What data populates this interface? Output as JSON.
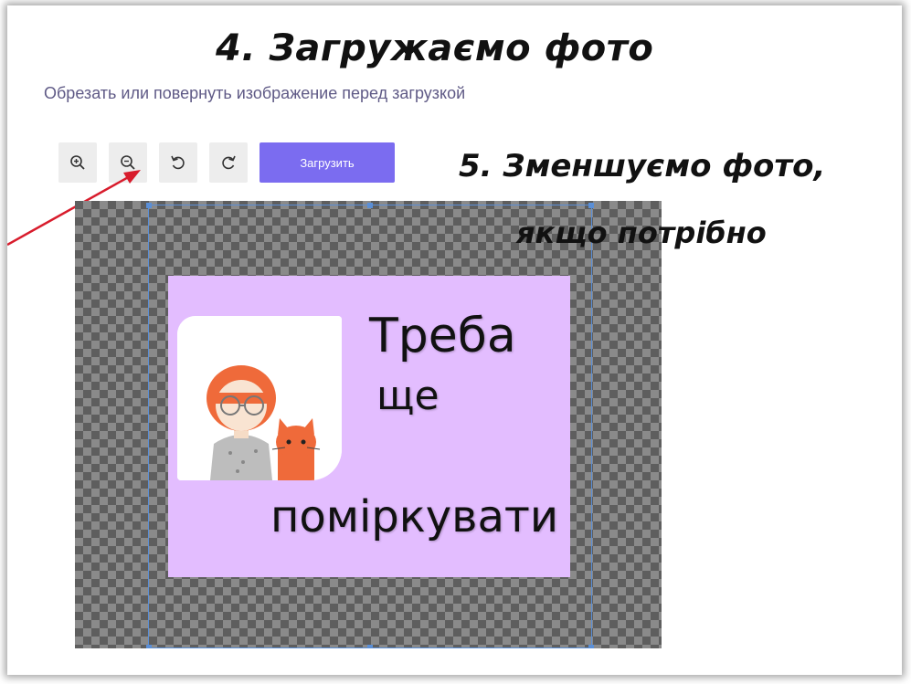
{
  "header": {
    "step4_title": "4. Загружаємо фото",
    "subtitle": "Обрезать или повернуть изображение перед загрузкой"
  },
  "toolbar": {
    "zoom_in_icon": "zoom-in-icon",
    "zoom_out_icon": "zoom-out-icon",
    "rotate_left_icon": "rotate-left-icon",
    "rotate_right_icon": "rotate-right-icon",
    "upload_label": "Загрузить",
    "upload_color": "#7b6cf0"
  },
  "annotation": {
    "step5_line1": "5. Зменшуємо фото,",
    "step5_line2": "якщо потрібно",
    "arrow_color": "#d81c2c"
  },
  "image": {
    "background_color": "#e3bdff",
    "line1": "Треба",
    "line2": "ще",
    "line3": "поміркувати"
  },
  "crop": {
    "border_color": "#5b8fd6"
  }
}
